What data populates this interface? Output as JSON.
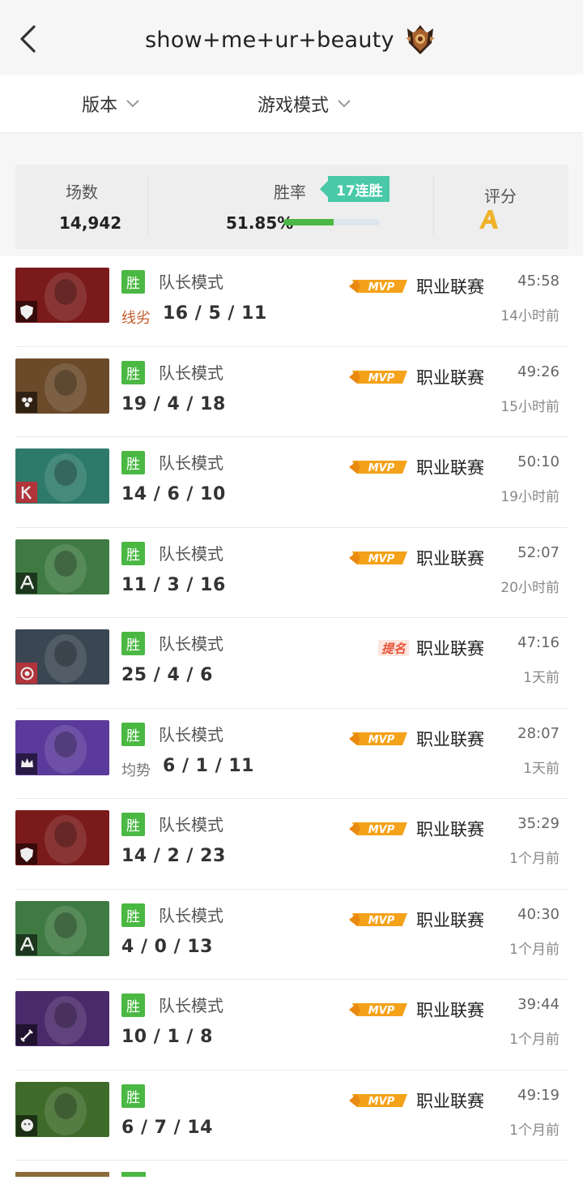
{
  "header": {
    "title": "show+me+ur+beauty"
  },
  "filters": {
    "version_label": "版本",
    "mode_label": "游戏模式"
  },
  "stats": {
    "matches_label": "场数",
    "matches_value": "14,942",
    "winrate_label": "胜率",
    "winrate_value": "51.85%",
    "winrate_fraction": 0.5185,
    "streak_label": "17连胜",
    "score_label": "评分",
    "score_grade": "A"
  },
  "matches": [
    {
      "result": "胜",
      "mode": "队长模式",
      "lane": "线劣",
      "kda": "16/5/11",
      "badge": "MVP",
      "league": "职业联赛",
      "duration": "45:58",
      "ago": "14小时前",
      "hero_color": "#7a1a1a",
      "role_icon": "shield-icon"
    },
    {
      "result": "胜",
      "mode": "队长模式",
      "lane": "",
      "kda": "19/4/18",
      "badge": "MVP",
      "league": "职业联赛",
      "duration": "49:26",
      "ago": "15小时前",
      "hero_color": "#6b4a2a",
      "role_icon": "cluster-icon"
    },
    {
      "result": "胜",
      "mode": "队长模式",
      "lane": "",
      "kda": "14/6/10",
      "badge": "MVP",
      "league": "职业联赛",
      "duration": "50:10",
      "ago": "19小时前",
      "hero_color": "#2d7a6a",
      "role_icon": "k-arrow-icon"
    },
    {
      "result": "胜",
      "mode": "队长模式",
      "lane": "",
      "kda": "11/3/16",
      "badge": "MVP",
      "league": "职业联赛",
      "duration": "52:07",
      "ago": "20小时前",
      "hero_color": "#3f7a42",
      "role_icon": "a-letter-icon"
    },
    {
      "result": "胜",
      "mode": "队长模式",
      "lane": "",
      "kda": "25/4/6",
      "badge": "提名",
      "league": "职业联赛",
      "duration": "47:16",
      "ago": "1天前",
      "hero_color": "#3a4652",
      "role_icon": "target-icon"
    },
    {
      "result": "胜",
      "mode": "队长模式",
      "lane": "均势",
      "kda": "6/1/11",
      "badge": "MVP",
      "league": "职业联赛",
      "duration": "28:07",
      "ago": "1天前",
      "hero_color": "#5a3a9a",
      "role_icon": "crown-icon"
    },
    {
      "result": "胜",
      "mode": "队长模式",
      "lane": "",
      "kda": "14/2/23",
      "badge": "MVP",
      "league": "职业联赛",
      "duration": "35:29",
      "ago": "1个月前",
      "hero_color": "#7a1a1a",
      "role_icon": "shield-icon"
    },
    {
      "result": "胜",
      "mode": "队长模式",
      "lane": "",
      "kda": "4/0/13",
      "badge": "MVP",
      "league": "职业联赛",
      "duration": "40:30",
      "ago": "1个月前",
      "hero_color": "#3f7a42",
      "role_icon": "a-letter-icon"
    },
    {
      "result": "胜",
      "mode": "队长模式",
      "lane": "",
      "kda": "10/1/8",
      "badge": "MVP",
      "league": "职业联赛",
      "duration": "39:44",
      "ago": "1个月前",
      "hero_color": "#4a2a6a",
      "role_icon": "sword-icon"
    },
    {
      "result": "胜",
      "mode": "",
      "lane": "",
      "kda": "6/7/14",
      "badge": "MVP",
      "league": "职业联赛",
      "duration": "49:19",
      "ago": "1个月前",
      "hero_color": "#3e6a2a",
      "role_icon": "smiley-icon"
    }
  ]
}
